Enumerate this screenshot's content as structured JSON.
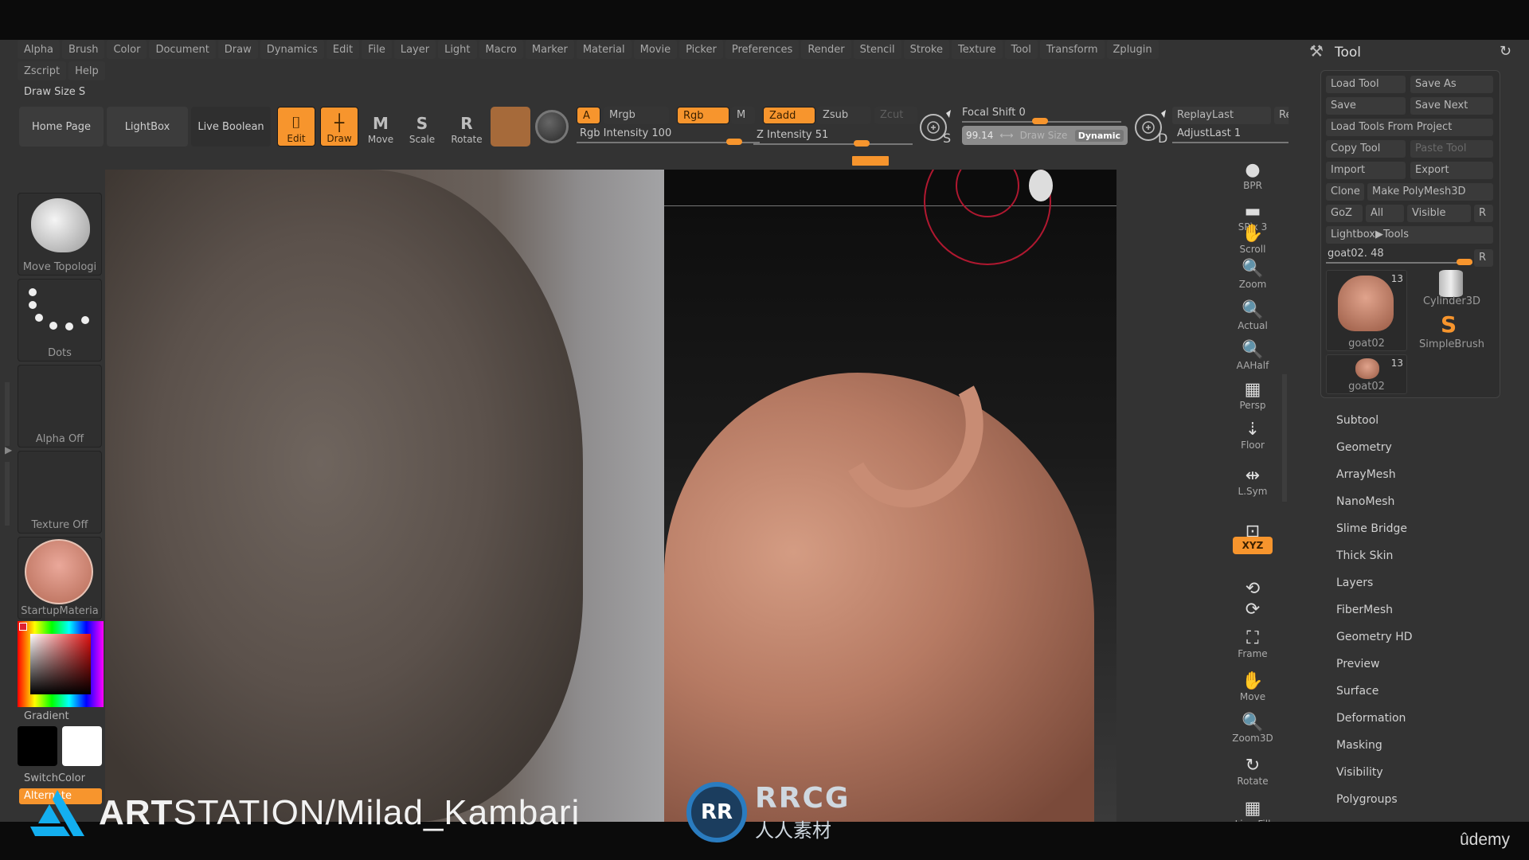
{
  "menu": {
    "row1": [
      "Alpha",
      "Brush",
      "Color",
      "Document",
      "Draw",
      "Dynamics",
      "Edit",
      "File",
      "Layer",
      "Light",
      "Macro",
      "Marker",
      "Material",
      "Movie",
      "Picker",
      "Preferences",
      "Render",
      "Stencil",
      "Stroke",
      "Texture",
      "Tool",
      "Transform",
      "Zplugin"
    ],
    "row2": [
      "Zscript",
      "Help"
    ]
  },
  "status": {
    "draw_size": "Draw Size S"
  },
  "toolbar": {
    "home_page": "Home Page",
    "lightbox": "LightBox",
    "live_boolean": "Live Boolean",
    "edit": "Edit",
    "draw": "Draw",
    "move": "Move",
    "scale": "Scale",
    "rotate": "Rotate",
    "a": "A",
    "mrgb": "Mrgb",
    "rgb": "Rgb",
    "m": "M",
    "zadd": "Zadd",
    "zsub": "Zsub",
    "zcut": "Zcut",
    "rgb_intensity_label": "Rgb Intensity",
    "rgb_intensity": "100",
    "z_intensity_label": "Z Intensity",
    "z_intensity": "51",
    "focal_shift_label": "Focal Shift",
    "focal_shift": "0",
    "draw_size_value": "99.14",
    "draw_size_label": "Draw Size",
    "dynamic": "Dynamic",
    "s_label": "S",
    "d_label": "D",
    "replay_last": "ReplayLast",
    "re": "Re",
    "adjust_last_label": "AdjustLast",
    "adjust_last": "1"
  },
  "left_tray": {
    "brush": "Move Topologi",
    "stroke": "Dots",
    "alpha": "Alpha Off",
    "texture": "Texture Off",
    "material": "StartupMateria",
    "gradient": "Gradient",
    "switch_color": "SwitchColor",
    "alternate": "Alternate"
  },
  "right_shelf": [
    {
      "label": "BPR",
      "icon": "sphere-icon"
    },
    {
      "label": "SPix 3",
      "icon": "slider-icon"
    },
    {
      "label": "Scroll",
      "icon": "hand-icon"
    },
    {
      "label": "Zoom",
      "icon": "magnifier-icon"
    },
    {
      "label": "Actual",
      "icon": "magnifier-icon"
    },
    {
      "label": "AAHalf",
      "icon": "magnifier-icon"
    },
    {
      "label": "Persp",
      "icon": "grid-icon"
    },
    {
      "label": "Floor",
      "icon": "floor-icon"
    },
    {
      "label": "L.Sym",
      "icon": "symmetry-icon"
    },
    {
      "label": "",
      "icon": "lock-icon"
    },
    {
      "label": "XYZ",
      "icon": "xyz-icon"
    },
    {
      "label": "",
      "icon": "rotate-y-icon"
    },
    {
      "label": "",
      "icon": "rotate-z-icon"
    },
    {
      "label": "Frame",
      "icon": "frame-icon"
    },
    {
      "label": "Move",
      "icon": "hand-icon"
    },
    {
      "label": "Zoom3D",
      "icon": "magnifier-icon"
    },
    {
      "label": "Rotate",
      "icon": "rotate-icon"
    },
    {
      "label": "Line Fill",
      "icon": "polyframe-icon"
    }
  ],
  "right_shelf_dynamic": "Dynamic",
  "tool_palette": {
    "title": "Tool",
    "buttons": {
      "load_tool": "Load Tool",
      "save_as": "Save As",
      "save": "Save",
      "save_next": "Save Next",
      "load_from_project": "Load Tools From Project",
      "copy_tool": "Copy Tool",
      "paste_tool": "Paste Tool",
      "import": "Import",
      "export": "Export",
      "clone": "Clone",
      "make_polymesh": "Make PolyMesh3D",
      "goz": "GoZ",
      "all": "All",
      "visible": "Visible",
      "r": "R",
      "lightbox_tools": "Lightbox▶Tools"
    },
    "slider_label": "goat02.",
    "slider_value": "48",
    "tools": [
      {
        "name": "goat02",
        "count": "13"
      },
      {
        "name": "Cylinder3D",
        "count": ""
      },
      {
        "name": "SimpleBrush",
        "count": ""
      },
      {
        "name": "goat02",
        "count": "13"
      }
    ],
    "subpalettes": [
      "Subtool",
      "Geometry",
      "ArrayMesh",
      "NanoMesh",
      "Slime Bridge",
      "Thick Skin",
      "Layers",
      "FiberMesh",
      "Geometry HD",
      "Preview",
      "Surface",
      "Deformation",
      "Masking",
      "Visibility",
      "Polygroups"
    ]
  },
  "overlay": {
    "artstation_bold": "ART",
    "artstation_rest": "STATION/Milad_Kambari",
    "rrcg_top": "RRCG",
    "rrcg_bottom": "人人素材",
    "udemy": "ûdemy"
  },
  "colors": {
    "accent": "#f7952d",
    "panel": "#333333",
    "viewport_bg": "#0c0c0c",
    "gizmo_ring": "#b01830"
  }
}
